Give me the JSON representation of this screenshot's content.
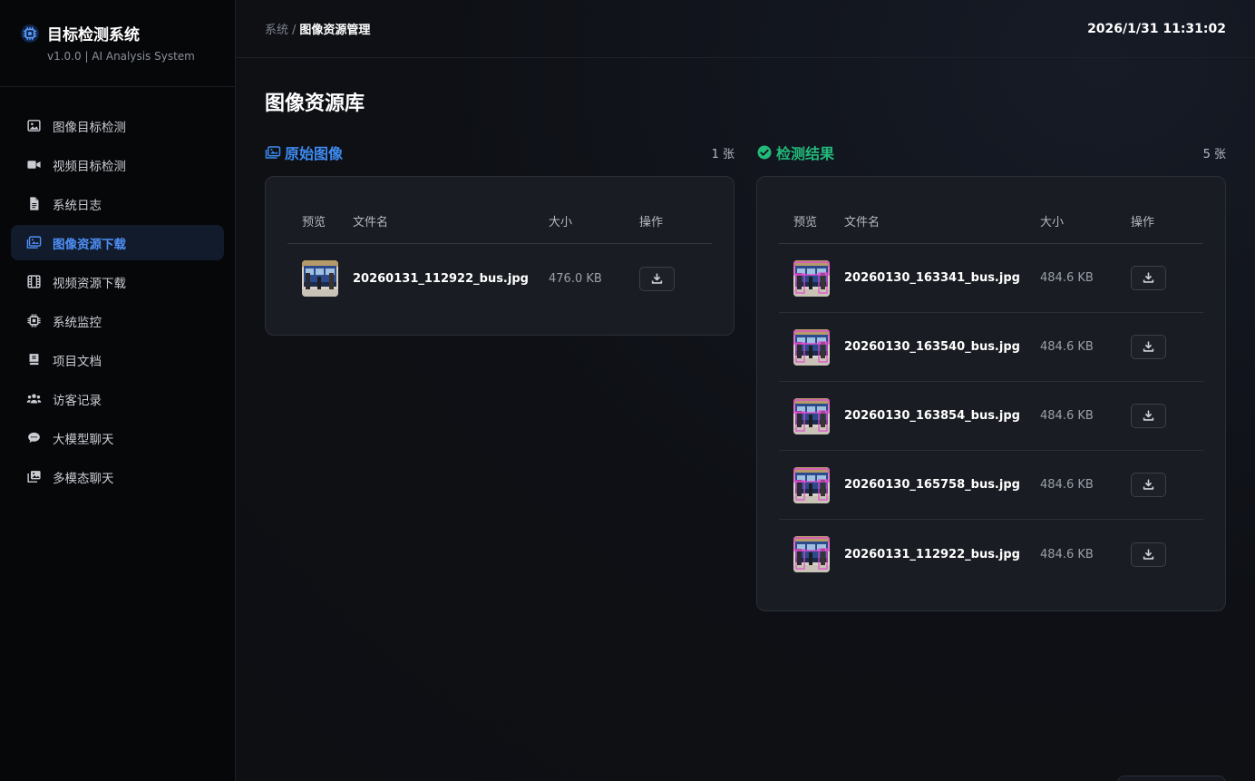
{
  "brand": {
    "title": "目标检测系统",
    "subtitle": "v1.0.0 | AI Analysis System"
  },
  "sidebar": {
    "items": [
      {
        "label": "图像目标检测",
        "icon": "image-icon",
        "active": false
      },
      {
        "label": "视频目标检测",
        "icon": "video-camera-icon",
        "active": false
      },
      {
        "label": "系统日志",
        "icon": "file-icon",
        "active": false
      },
      {
        "label": "图像资源下载",
        "icon": "images-icon",
        "active": true
      },
      {
        "label": "视频资源下载",
        "icon": "film-icon",
        "active": false
      },
      {
        "label": "系统监控",
        "icon": "cpu-icon",
        "active": false
      },
      {
        "label": "项目文档",
        "icon": "book-icon",
        "active": false
      },
      {
        "label": "访客记录",
        "icon": "users-icon",
        "active": false
      },
      {
        "label": "大模型聊天",
        "icon": "chat-icon",
        "active": false
      },
      {
        "label": "多模态聊天",
        "icon": "photo-stack-icon",
        "active": false
      }
    ]
  },
  "header": {
    "breadcrumb_root": "系统",
    "breadcrumb_sep": "/",
    "breadcrumb_current": "图像资源管理",
    "datetime": "2026/1/31 11:31:02"
  },
  "page": {
    "title": "图像资源库"
  },
  "table_headers": {
    "preview": "预览",
    "filename": "文件名",
    "size": "大小",
    "action": "操作"
  },
  "original": {
    "title": "原始图像",
    "count": "1 张",
    "accent": "#3d8bf0",
    "files": [
      {
        "name": "20260131_112922_bus.jpg",
        "size": "476.0 KB"
      }
    ]
  },
  "results": {
    "title": "检测结果",
    "count": "5 张",
    "accent": "#22b97a",
    "files": [
      {
        "name": "20260130_163341_bus.jpg",
        "size": "484.6 KB"
      },
      {
        "name": "20260130_163540_bus.jpg",
        "size": "484.6 KB"
      },
      {
        "name": "20260130_163854_bus.jpg",
        "size": "484.6 KB"
      },
      {
        "name": "20260130_165758_bus.jpg",
        "size": "484.6 KB"
      },
      {
        "name": "20260131_112922_bus.jpg",
        "size": "484.6 KB"
      }
    ]
  }
}
